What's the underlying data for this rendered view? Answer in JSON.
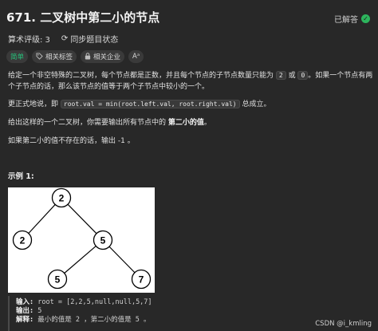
{
  "problem": {
    "title": "671. 二叉树中第二小的节点",
    "status": "已解答"
  },
  "meta": {
    "rating": "算术评级: 3",
    "sync": "同步题目状态"
  },
  "tags": [
    {
      "label": "简单",
      "icon": ""
    },
    {
      "label": "相关标签",
      "icon": "tag-icon"
    },
    {
      "label": "相关企业",
      "icon": "lock-icon"
    },
    {
      "label": "Aᵃ",
      "icon": ""
    }
  ],
  "description": {
    "p1_a": "给定一个非空特殊的二叉树，每个节点都是正数，并且每个节点的子节点数量只能为 ",
    "p1_code1": "2",
    "p1_b": " 或 ",
    "p1_code2": "0",
    "p1_c": "。如果一个节点有两个子节点的话，那么该节点的值等于两个子节点中较小的一个。",
    "p2_a": "更正式地说，即 ",
    "p2_code": "root.val = min(root.left.val, root.right.val)",
    "p2_b": " 总成立。",
    "p3_a": "给出这样的一个二叉树，你需要输出所有节点中的 ",
    "p3_strong": "第二小的值",
    "p3_b": "。",
    "p4": "如果第二小的值不存在的话，输出 -1 。"
  },
  "example": {
    "title": "示例 1:",
    "tree_nodes": [
      "2",
      "2",
      "5",
      "5",
      "7"
    ],
    "input_label": "输入:",
    "input_value": "root = [2,2,5,null,null,5,7]",
    "output_label": "输出:",
    "output_value": "5",
    "explain_label": "解释:",
    "explain_value": "最小的值是 2 ，第二小的值是 5 。"
  },
  "watermark": "CSDN @i_kmling"
}
